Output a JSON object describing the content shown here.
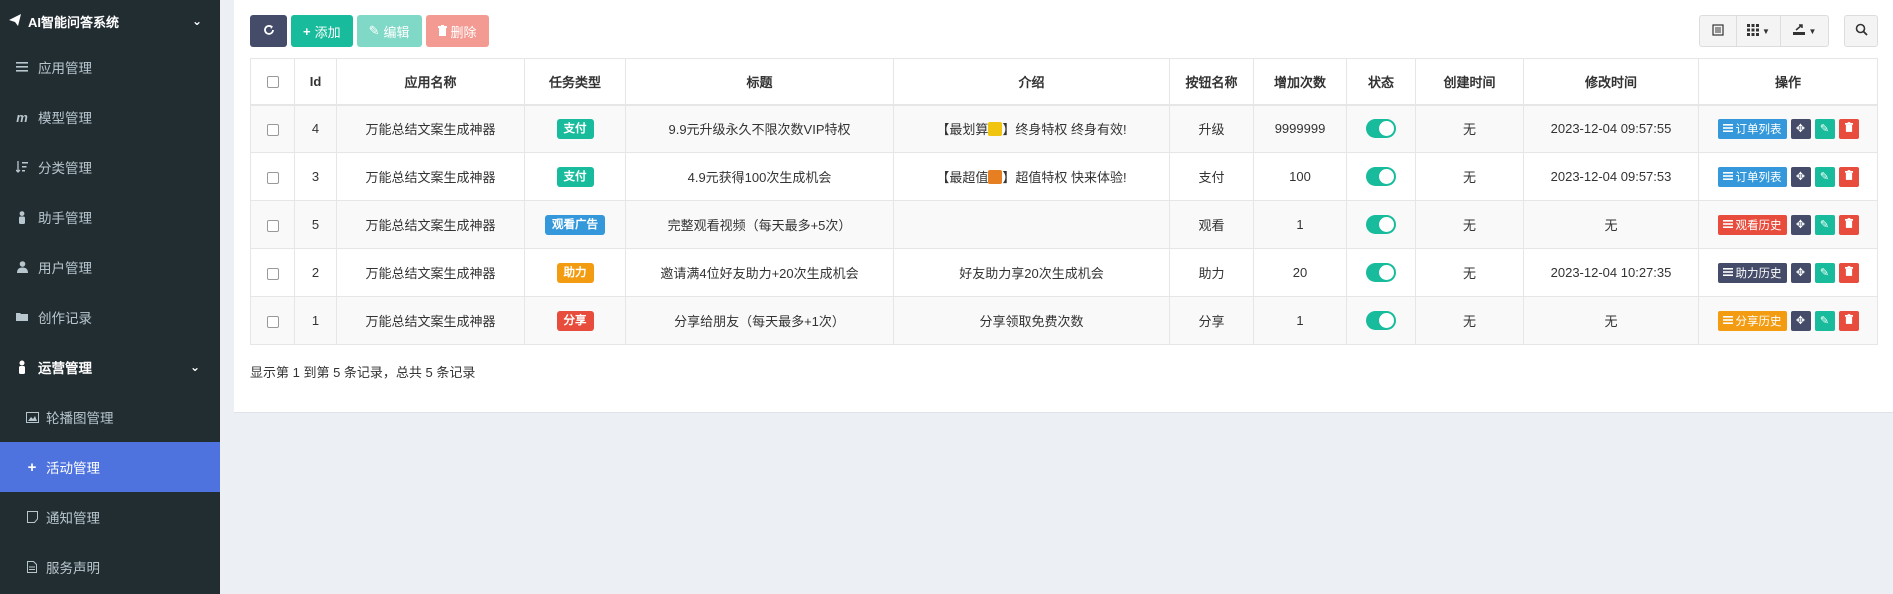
{
  "app": {
    "title": "AI智能问答系统"
  },
  "sidebar": {
    "items": [
      {
        "label": "应用管理",
        "icon": "list-icon"
      },
      {
        "label": "模型管理",
        "icon": "m-icon"
      },
      {
        "label": "分类管理",
        "icon": "sort-icon"
      },
      {
        "label": "助手管理",
        "icon": "person-icon"
      },
      {
        "label": "用户管理",
        "icon": "user-icon"
      },
      {
        "label": "创作记录",
        "icon": "folder-icon"
      }
    ],
    "group": {
      "label": "运营管理",
      "icon": "person-icon"
    },
    "subitems": [
      {
        "label": "轮播图管理",
        "icon": "image-icon"
      },
      {
        "label": "活动管理",
        "icon": "plus-icon",
        "active": true
      },
      {
        "label": "通知管理",
        "icon": "note-icon"
      },
      {
        "label": "服务声明",
        "icon": "file-icon"
      }
    ]
  },
  "toolbar": {
    "add_label": "添加",
    "edit_label": "编辑",
    "delete_label": "删除"
  },
  "table": {
    "headers": [
      "Id",
      "应用名称",
      "任务类型",
      "标题",
      "介绍",
      "按钮名称",
      "增加次数",
      "状态",
      "创建时间",
      "修改时间",
      "操作"
    ],
    "rows": [
      {
        "id": "4",
        "app": "万能总结文案生成神器",
        "type": "支付",
        "type_color": "#18bc9c",
        "title": "9.9元升级永久不限次数VIP特权",
        "intro_pre": "【最划算",
        "intro_post": "】终身特权 终身有效!",
        "emoji_color": "#f1c40f",
        "button": "升级",
        "count": "9999999",
        "created": "无",
        "modified": "2023-12-04 09:57:55",
        "action": "订单列表",
        "action_color": "#3498db"
      },
      {
        "id": "3",
        "app": "万能总结文案生成神器",
        "type": "支付",
        "type_color": "#18bc9c",
        "title": "4.9元获得100次生成机会",
        "intro_pre": "【最超值",
        "intro_post": "】超值特权 快来体验!",
        "emoji_color": "#e67e22",
        "button": "支付",
        "count": "100",
        "created": "无",
        "modified": "2023-12-04 09:57:53",
        "action": "订单列表",
        "action_color": "#3498db"
      },
      {
        "id": "5",
        "app": "万能总结文案生成神器",
        "type": "观看广告",
        "type_color": "#3498db",
        "title": "完整观看视频（每天最多+5次）",
        "intro_pre": "",
        "intro_post": "",
        "emoji_color": "",
        "button": "观看",
        "count": "1",
        "created": "无",
        "modified": "无",
        "action": "观看历史",
        "action_color": "#e74c3c"
      },
      {
        "id": "2",
        "app": "万能总结文案生成神器",
        "type": "助力",
        "type_color": "#f39c12",
        "title": "邀请满4位好友助力+20次生成机会",
        "intro_pre": "好友助力享20次生成机会",
        "intro_post": "",
        "emoji_color": "",
        "button": "助力",
        "count": "20",
        "created": "无",
        "modified": "2023-12-04 10:27:35",
        "action": "助力历史",
        "action_color": "#444c69"
      },
      {
        "id": "1",
        "app": "万能总结文案生成神器",
        "type": "分享",
        "type_color": "#e74c3c",
        "title": "分享给朋友（每天最多+1次）",
        "intro_pre": "分享领取免费次数",
        "intro_post": "",
        "emoji_color": "",
        "button": "分享",
        "count": "1",
        "created": "无",
        "modified": "无",
        "action": "分享历史",
        "action_color": "#f39c12"
      }
    ]
  },
  "footer": {
    "info": "显示第 1 到第 5 条记录，总共 5 条记录"
  },
  "colors": {
    "sidebar_bg": "#222d32",
    "active_bg": "#4e73df",
    "toggle_on": "#18bc9c"
  }
}
